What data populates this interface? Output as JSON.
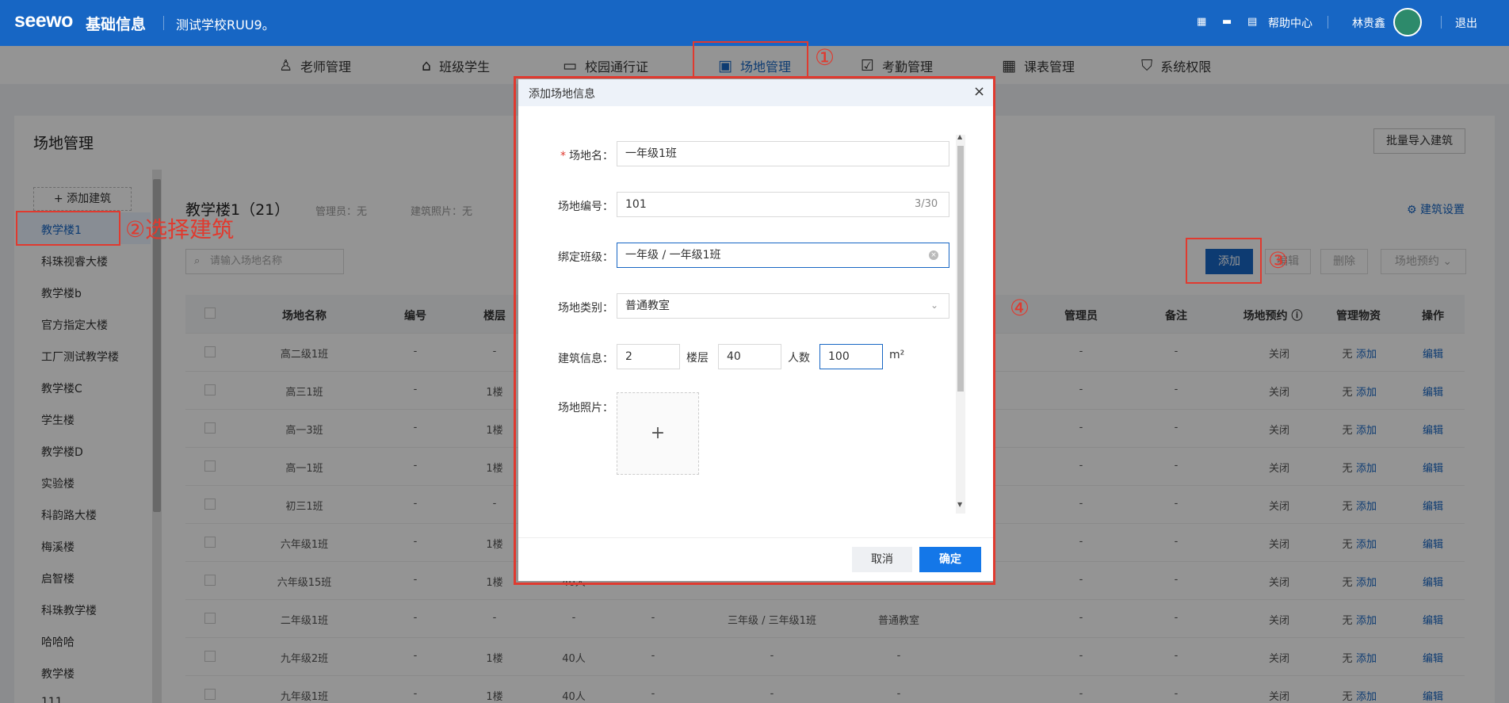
{
  "header": {
    "logo": "seewo",
    "app_name": "基础信息",
    "school": "测试学校RUU9。",
    "help": "帮助中心",
    "user": "林贵鑫",
    "logout": "退出"
  },
  "nav": {
    "items": [
      {
        "label": "老师管理",
        "icon": "person-icon"
      },
      {
        "label": "班级学生",
        "icon": "graduation-cap-icon"
      },
      {
        "label": "校园通行证",
        "icon": "id-card-icon"
      },
      {
        "label": "场地管理",
        "icon": "venue-icon",
        "active": true
      },
      {
        "label": "考勤管理",
        "icon": "clipboard-check-icon"
      },
      {
        "label": "课表管理",
        "icon": "calendar-icon"
      },
      {
        "label": "系统权限",
        "icon": "shield-icon"
      }
    ]
  },
  "page": {
    "title": "场地管理",
    "import_button": "批量导入建筑"
  },
  "sidebar": {
    "add_building": "+ 添加建筑",
    "buildings": [
      "教学楼1",
      "科珠视睿大楼",
      "教学楼b",
      "官方指定大楼",
      "工厂测试教学楼",
      "教学楼C",
      "学生楼",
      "教学楼D",
      "实验楼",
      "科韵路大楼",
      "梅溪楼",
      "启智楼",
      "科珠教学楼",
      "哈哈哈",
      "教学楼",
      "111"
    ],
    "selected": "教学楼1"
  },
  "building": {
    "title": "教学楼1（21）",
    "admin": "管理员：无",
    "photo": "建筑照片：无",
    "settings": "建筑设置",
    "search_placeholder": "请输入场地名称",
    "add": "添加",
    "batch_edit": "编辑",
    "delete": "删除",
    "reserve": "场地预约"
  },
  "table": {
    "headers": [
      "场地名称",
      "编号",
      "楼层",
      "管理员",
      "备注",
      "场地预约",
      "管理物资",
      "操作"
    ],
    "rows": [
      {
        "name": "高二级1班",
        "code": "-",
        "floor": "-",
        "cap": "",
        "f5": "",
        "cls": "",
        "type": "",
        "admin": "-",
        "note": "-",
        "reserve": "关闭",
        "goods": "无",
        "goods_add": "添加",
        "op": "编辑"
      },
      {
        "name": "高三1班",
        "code": "-",
        "floor": "1楼",
        "cap": "",
        "f5": "",
        "cls": "",
        "type": "",
        "admin": "-",
        "note": "-",
        "reserve": "关闭",
        "goods": "无",
        "goods_add": "添加",
        "op": "编辑"
      },
      {
        "name": "高一3班",
        "code": "-",
        "floor": "1楼",
        "cap": "",
        "f5": "",
        "cls": "",
        "type": "",
        "admin": "-",
        "note": "-",
        "reserve": "关闭",
        "goods": "无",
        "goods_add": "添加",
        "op": "编辑"
      },
      {
        "name": "高一1班",
        "code": "-",
        "floor": "1楼",
        "cap": "",
        "f5": "",
        "cls": "",
        "type": "",
        "admin": "-",
        "note": "-",
        "reserve": "关闭",
        "goods": "无",
        "goods_add": "添加",
        "op": "编辑"
      },
      {
        "name": "初三1班",
        "code": "-",
        "floor": "-",
        "cap": "",
        "f5": "",
        "cls": "",
        "type": "",
        "admin": "-",
        "note": "-",
        "reserve": "关闭",
        "goods": "无",
        "goods_add": "添加",
        "op": "编辑"
      },
      {
        "name": "六年级1班",
        "code": "-",
        "floor": "1楼",
        "cap": "",
        "f5": "",
        "cls": "",
        "type": "",
        "admin": "-",
        "note": "-",
        "reserve": "关闭",
        "goods": "无",
        "goods_add": "添加",
        "op": "编辑"
      },
      {
        "name": "六年级15班",
        "code": "-",
        "floor": "1楼",
        "cap": "40人",
        "f5": "-",
        "cls": "-",
        "type": "-",
        "admin": "-",
        "note": "-",
        "reserve": "关闭",
        "goods": "无",
        "goods_add": "添加",
        "op": "编辑"
      },
      {
        "name": "二年级1班",
        "code": "-",
        "floor": "-",
        "cap": "-",
        "f5": "-",
        "cls": "三年级 / 三年级1班",
        "type": "普通教室",
        "admin": "-",
        "note": "-",
        "reserve": "关闭",
        "goods": "无",
        "goods_add": "添加",
        "op": "编辑"
      },
      {
        "name": "九年级2班",
        "code": "-",
        "floor": "1楼",
        "cap": "40人",
        "f5": "-",
        "cls": "-",
        "type": "-",
        "admin": "-",
        "note": "-",
        "reserve": "关闭",
        "goods": "无",
        "goods_add": "添加",
        "op": "编辑"
      },
      {
        "name": "九年级1班",
        "code": "-",
        "floor": "1楼",
        "cap": "40人",
        "f5": "-",
        "cls": "-",
        "type": "-",
        "admin": "-",
        "note": "-",
        "reserve": "关闭",
        "goods": "无",
        "goods_add": "添加",
        "op": "编辑"
      }
    ]
  },
  "modal": {
    "title": "添加场地信息",
    "fields": {
      "name_label": "场地名：",
      "name_value": "一年级1班",
      "code_label": "场地编号：",
      "code_value": "101",
      "code_counter": "3/30",
      "class_label": "绑定班级：",
      "class_value": "一年级 / 一年级1班",
      "type_label": "场地类别：",
      "type_value": "普通教室",
      "info_label": "建筑信息：",
      "floor_value": "2",
      "floor_unit": "楼层",
      "people_value": "40",
      "people_unit": "人数",
      "area_value": "100",
      "area_unit": "m²",
      "photo_label": "场地照片："
    },
    "cancel": "取消",
    "confirm": "确定"
  },
  "annotations": {
    "step1": "①",
    "step2": "②选择建筑",
    "step3": "③",
    "step4": "④",
    "color": "#e03a2f"
  },
  "colors": {
    "primary": "#1766c4",
    "confirm": "#1477e8"
  }
}
